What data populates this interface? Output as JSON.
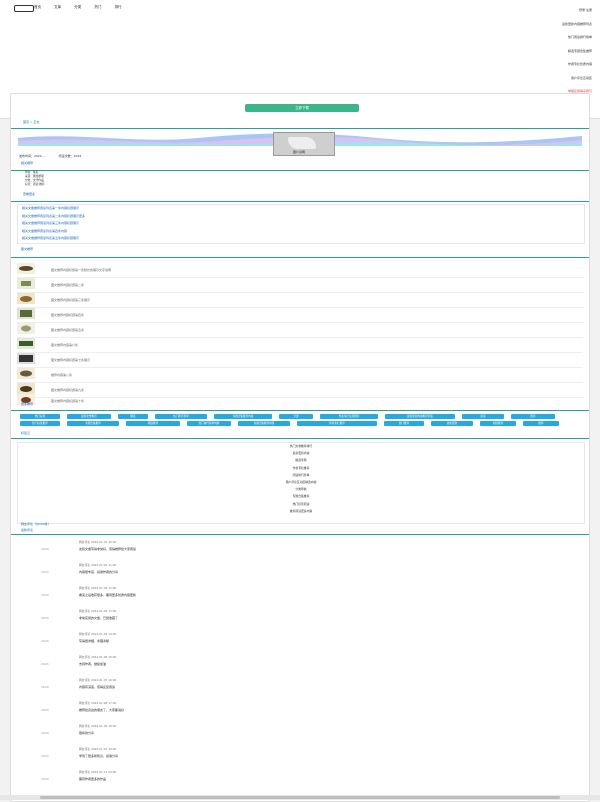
{
  "nav": {
    "items": [
      "首页",
      "文库",
      "分类",
      "热门",
      "排行"
    ]
  },
  "right_links": [
    {
      "label": "登录 注册",
      "color": "#333333"
    },
    {
      "label": "最新更新内容推荐列表",
      "color": "#333333"
    },
    {
      "label": "热门阅读排行榜单",
      "color": "#333333"
    },
    {
      "label": "精选专题合集推荐",
      "color": "#333333"
    },
    {
      "label": "作者专栏优质内容",
      "color": "#333333"
    },
    {
      "label": "用户评论互动区",
      "color": "#333333"
    },
    {
      "label": "举报反馈联系我们",
      "color": "#e53935"
    }
  ],
  "main": {
    "top_button": "立即下载",
    "breadcrumb": "首页 > 正文",
    "photo_caption": "图片说明",
    "meta_left": "发布时间：2024-...",
    "meta_right": "阅读次数：1024",
    "section1": "相关推荐",
    "info_lines": [
      "作者：佚名",
      "来源：网络整理",
      "分类：文学作品",
      "标签：阅读 推荐"
    ],
    "more_label": "查看更多",
    "link_list": [
      "相关文章推荐阅读列表第一条内容标题展示",
      "相关文章推荐阅读列表第二条内容标题展示更多",
      "相关文章推荐阅读列表第三条内容标题展示",
      "相关文章推荐阅读列表第四条内容",
      "相关文章推荐阅读列表第五条内容标题展示"
    ],
    "section2": "图文推荐",
    "thumb_items": [
      "图文推荐内容标题第一条较长的展示文字说明",
      "图文推荐内容标题第二条",
      "图文推荐内容标题第三条展示",
      "图文推荐内容标题第四条",
      "图文推荐内容标题第五条",
      "图文推荐内容第六条",
      "图文推荐内容标题第七条展示",
      "推荐内容第八条",
      "图文推荐内容标题第九条",
      "图文推荐内容标题第十条"
    ],
    "thumb_more": "更多推荐",
    "tags_row1": [
      "热门标签",
      "最新文章推荐",
      "精选",
      "热门排行榜单",
      "专题合集推荐内容",
      "分类",
      "作者专栏优质推荐",
      "最新更新内容推荐列表",
      "阅读",
      "推荐"
    ],
    "tags_row2": [
      "热门标签推荐",
      "专题合集推荐",
      "精选推荐",
      "热门排行榜单内容",
      "专题合集推荐内容",
      "作者专栏推荐",
      "热门推荐",
      "最新更新",
      "阅读推荐",
      "推荐"
    ],
    "tag_more": "标签云",
    "center_list": [
      "热门文章推荐排行",
      "最新更新内容",
      "精选专题",
      "作者专栏推荐",
      "阅读排行榜单",
      "用户评论互动区精选内容",
      "分类导航",
      "专题合集推荐",
      "热门标签阅读",
      "推荐阅读更多内容"
    ],
    "comments_head": "网友评论（共100条）",
    "comments_sub": "最新评论",
    "entries": [
      {
        "time": "2024",
        "meta": "网友评论 2024-01-01 10:00",
        "text": "这篇文章写得非常好，值得推荐给大家阅读"
      },
      {
        "time": "2024",
        "meta": "网友评论 2024-01-02 11:00",
        "text": "内容很丰富，感谢作者的分享"
      },
      {
        "time": "2024",
        "meta": "网友评论 2024-01-03 12:00",
        "text": "看完之后收获很多，期待更多优质内容更新"
      },
      {
        "time": "2024",
        "meta": "网友评论 2024-01-04 13:00",
        "text": "非常实用的文章，已经收藏了"
      },
      {
        "time": "2024",
        "meta": "网友评论 2024-01-05 14:00",
        "text": "写得很详细，条理清晰"
      },
      {
        "time": "2024",
        "meta": "网友评论 2024-01-06 15:00",
        "text": "支持作者，继续加油"
      },
      {
        "time": "2024",
        "meta": "网友评论 2024-01-07 16:00",
        "text": "内容有深度，值得反复阅读"
      },
      {
        "time": "2024",
        "meta": "网友评论 2024-01-08 17:00",
        "text": "推荐给身边的朋友了，大家都说好"
      },
      {
        "time": "2024",
        "meta": "网友评论 2024-01-09 18:00",
        "text": "很棒的分享"
      },
      {
        "time": "2024",
        "meta": "网友评论 2024-01-10 19:00",
        "text": "学到了很多新知识，感谢分享"
      },
      {
        "time": "2024",
        "meta": "网友评论 2024-01-11 20:00",
        "text": "期待作者更多的作品"
      }
    ]
  }
}
